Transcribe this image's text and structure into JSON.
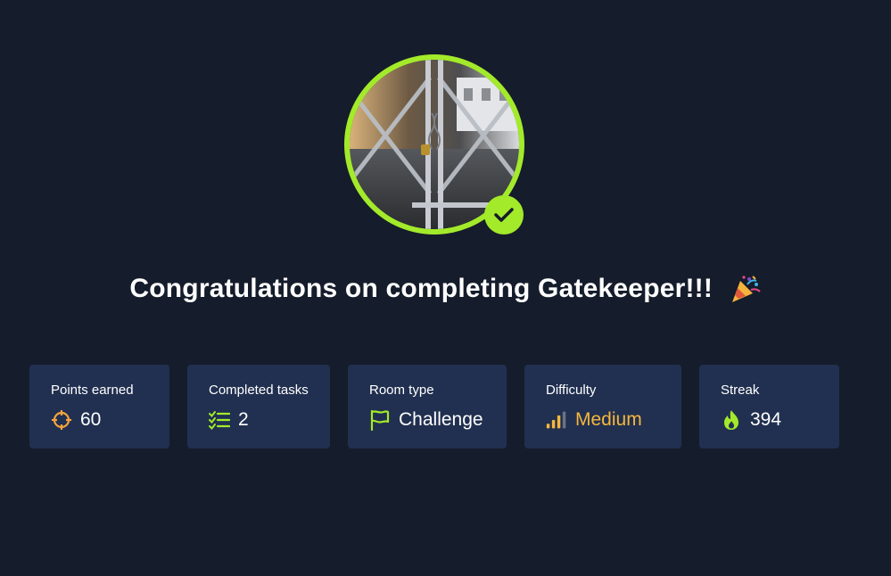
{
  "headline": {
    "text": "Congratulations on completing Gatekeeper!!!",
    "emoji_icon": "party-popper-icon"
  },
  "avatar": {
    "alt": "Gatekeeper room image",
    "badge_icon": "checkmark-icon"
  },
  "stats": [
    {
      "label": "Points earned",
      "value": "60",
      "icon": "crosshair-icon"
    },
    {
      "label": "Completed tasks",
      "value": "2",
      "icon": "checklist-icon"
    },
    {
      "label": "Room type",
      "value": "Challenge",
      "icon": "flag-icon"
    },
    {
      "label": "Difficulty",
      "value": "Medium",
      "icon": "signal-bars-icon"
    },
    {
      "label": "Streak",
      "value": "394",
      "icon": "flame-icon"
    }
  ],
  "colors": {
    "background": "#151c2b",
    "card": "#213050",
    "accent_green": "#a3ea2a",
    "points_orange": "#f6a33c",
    "difficulty_medium": "#f6b73c"
  }
}
